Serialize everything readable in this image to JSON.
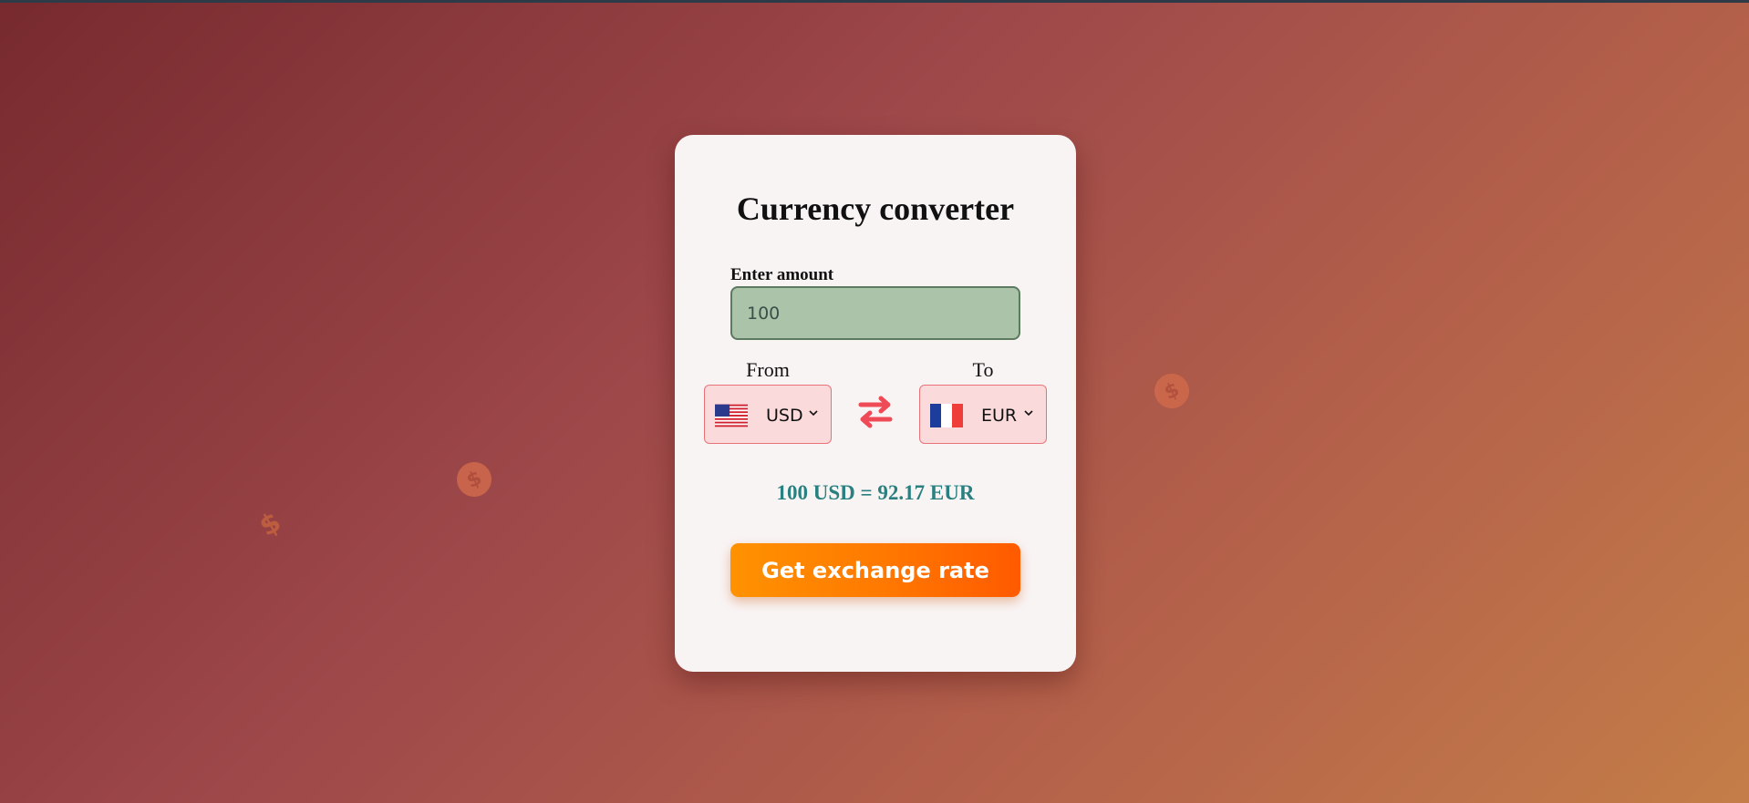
{
  "app": {
    "title": "Currency converter"
  },
  "amount": {
    "label": "Enter amount",
    "value": "100"
  },
  "from": {
    "label": "From",
    "currency": "USD",
    "flag_icon": "us-flag-icon"
  },
  "to": {
    "label": "To",
    "currency": "EUR",
    "flag_icon": "fr-flag-icon"
  },
  "swap_icon": "swap-arrows-icon",
  "result_text": "100 USD = 92.17 EUR",
  "button_label": "Get exchange rate",
  "background_icons": [
    "dollar-coin-icon",
    "dollar-coin-icon",
    "dollar-coin-icon"
  ],
  "colors": {
    "accent_orange": "#ff7a00",
    "result_teal": "#2a8080",
    "swap_red": "#ef4b57",
    "input_green": "#abc3a8",
    "select_pink": "#fbdadb"
  }
}
